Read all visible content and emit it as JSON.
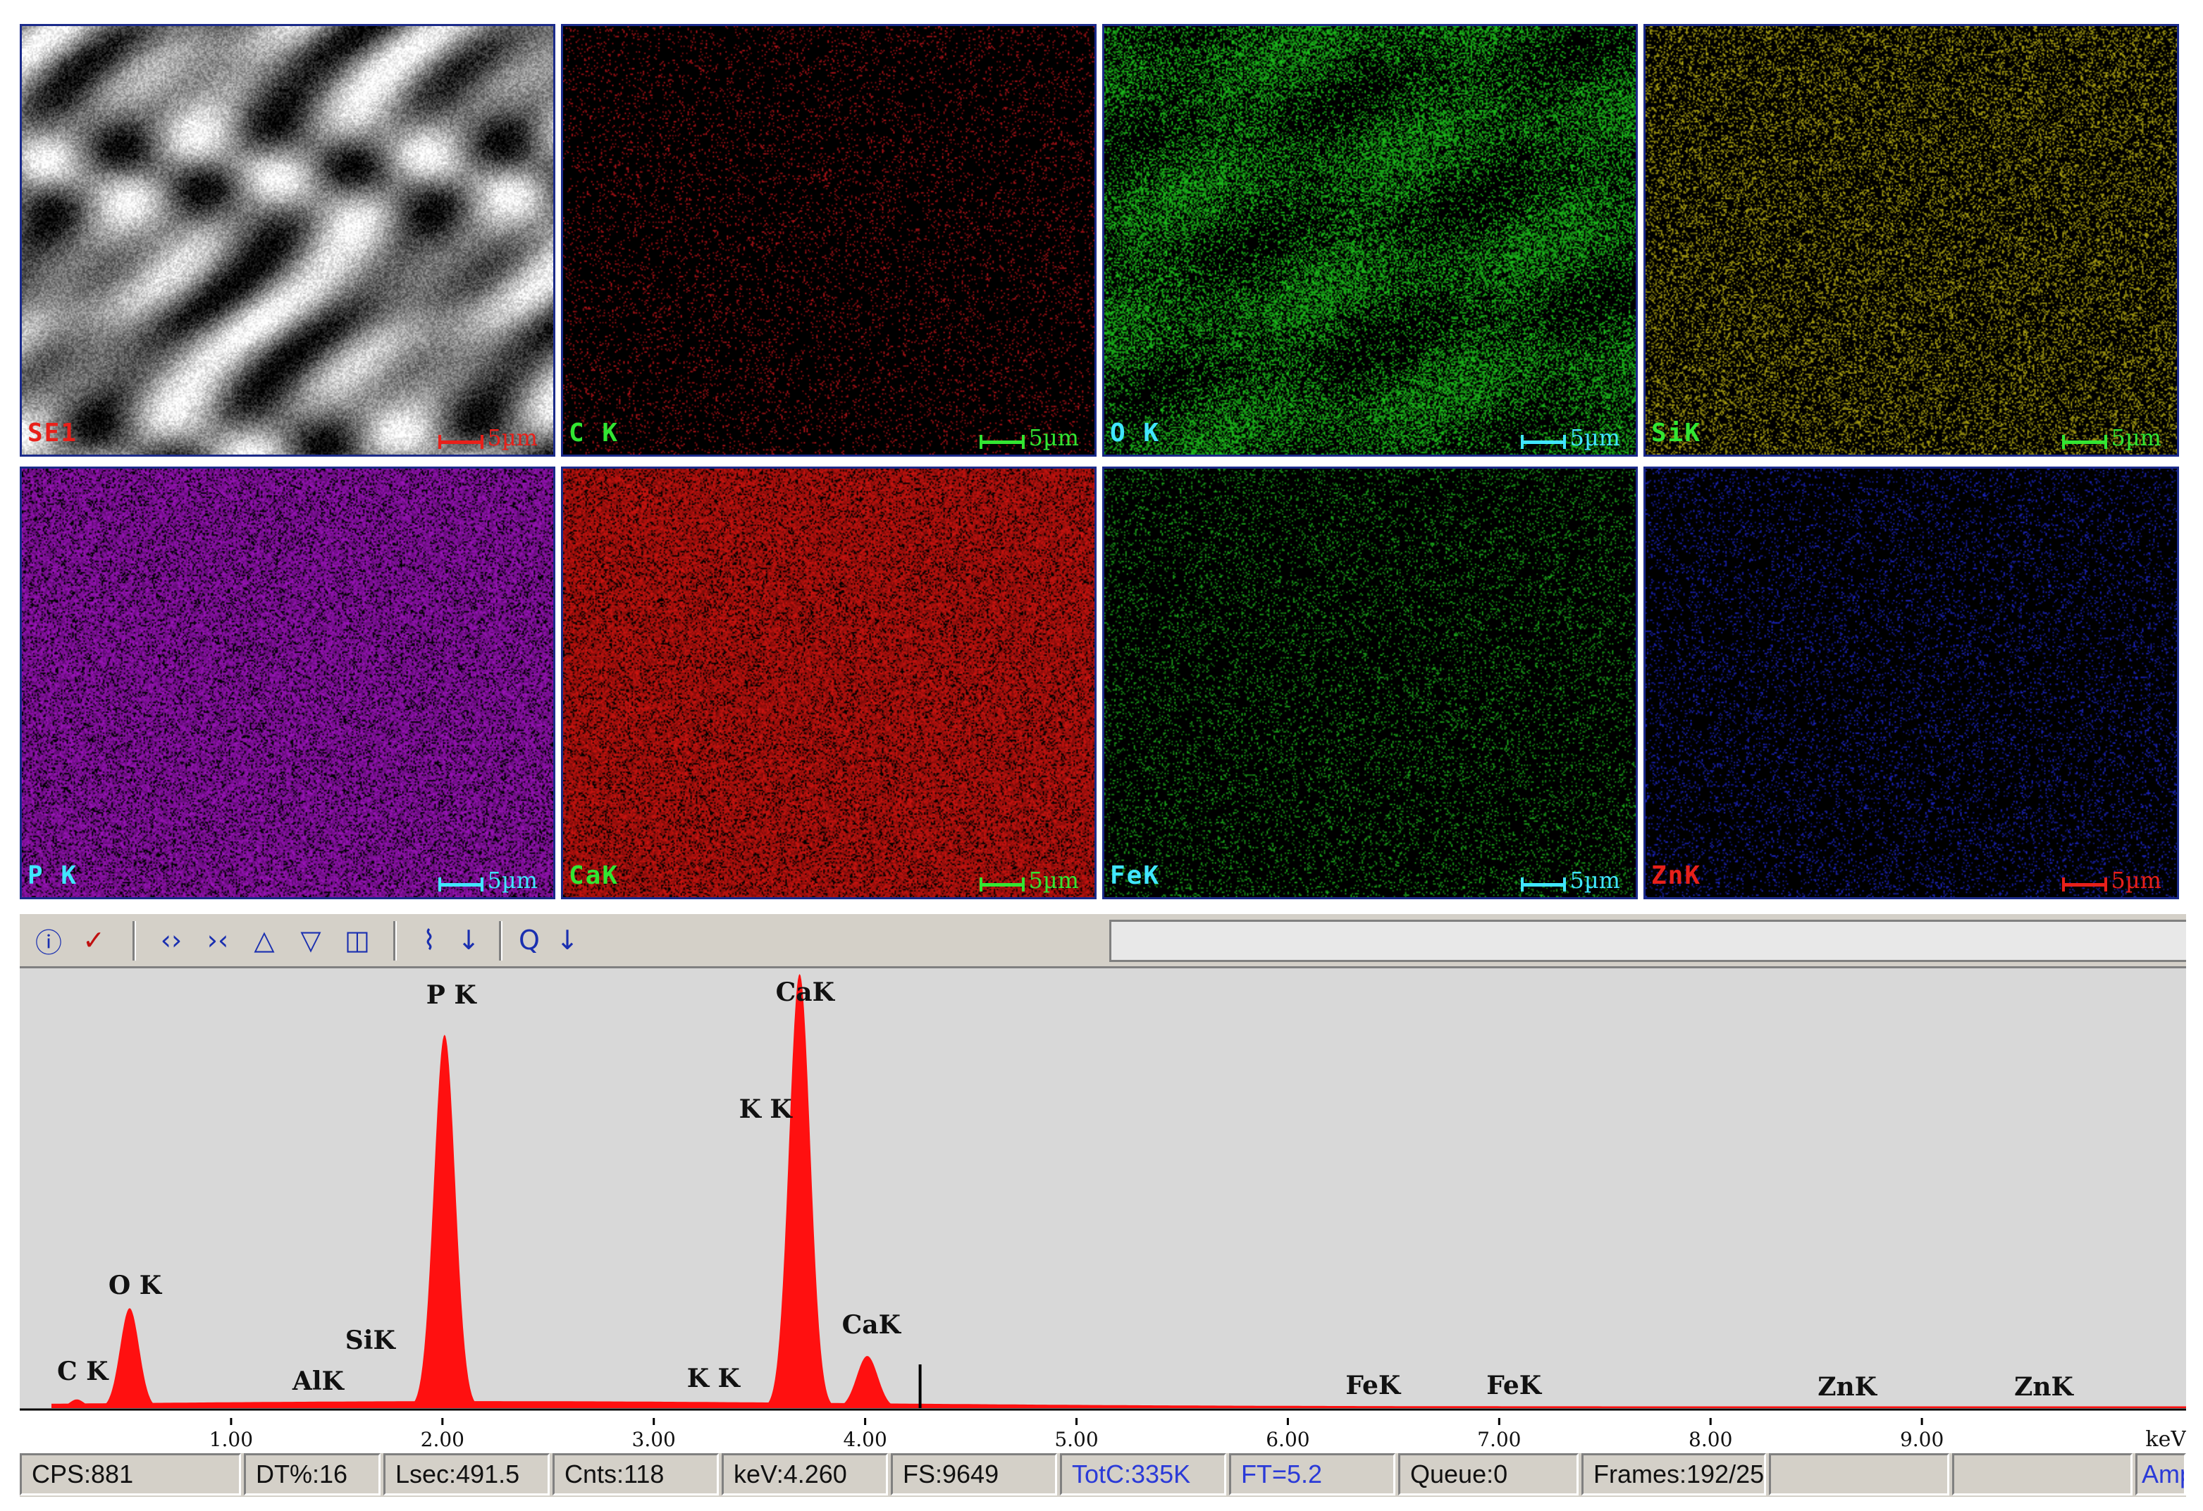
{
  "maps": [
    {
      "label": "SE1",
      "label_color": "#e8201a",
      "scale_text": "5µm",
      "scale_color": "#e8201a",
      "kind": "sem"
    },
    {
      "label": "C  K",
      "label_color": "#32e632",
      "scale_text": "5µm",
      "scale_color": "#32e632",
      "kind": "dots",
      "dot_color": "#c0141a",
      "density": 0.1
    },
    {
      "label": "O  K",
      "label_color": "#40e6ff",
      "scale_text": "5µm",
      "scale_color": "#40e6ff",
      "kind": "green",
      "dot_color": "#1ec81e",
      "density": 0.45
    },
    {
      "label": "SiK",
      "label_color": "#32e632",
      "scale_text": "5µm",
      "scale_color": "#32e632",
      "kind": "dots",
      "dot_color": "#b4aa14",
      "density": 0.28
    },
    {
      "label": "P  K",
      "label_color": "#40e6ff",
      "scale_text": "5µm",
      "scale_color": "#40e6ff",
      "kind": "dense",
      "dot_color": "#a014c0",
      "density": 0.8
    },
    {
      "label": "CaK",
      "label_color": "#32e632",
      "scale_text": "5µm",
      "scale_color": "#32e632",
      "kind": "dense",
      "dot_color": "#d21410",
      "density": 0.82
    },
    {
      "label": "FeK",
      "label_color": "#40e6ff",
      "scale_text": "5µm",
      "scale_color": "#40e6ff",
      "kind": "dots",
      "dot_color": "#1eb41e",
      "density": 0.14
    },
    {
      "label": "ZnK",
      "label_color": "#e8201a",
      "scale_text": "5µm",
      "scale_color": "#e8201a",
      "kind": "dots",
      "dot_color": "#1e28d2",
      "density": 0.12
    }
  ],
  "toolbar": {
    "icons": [
      "info-icon",
      "brush-icon",
      "expand-horizontal-icon",
      "compress-horizontal-icon",
      "expand-vertical-icon",
      "compress-vertical-icon",
      "eraser-icon",
      "peak-id-icon",
      "arrow-down-icon",
      "quantify-icon",
      "arrow-down-icon"
    ]
  },
  "chart_data": {
    "type": "line",
    "title": "",
    "xlabel": "keV",
    "ylabel": "",
    "xlim": [
      0,
      10.25
    ],
    "x_ticks": [
      "1.00",
      "2.00",
      "3.00",
      "4.00",
      "5.00",
      "6.00",
      "7.00",
      "8.00",
      "9.00"
    ],
    "x_tick_values": [
      1,
      2,
      3,
      4,
      5,
      6,
      7,
      8,
      9
    ],
    "marker_kev": 4.26,
    "peaks": [
      {
        "label": "C K",
        "kev": 0.27,
        "height": 0.02
      },
      {
        "label": "O K",
        "kev": 0.52,
        "height": 0.23
      },
      {
        "label": "AlK",
        "kev": 1.49,
        "height": 0.006
      },
      {
        "label": "SiK",
        "kev": 1.74,
        "height": 0.012
      },
      {
        "label": "P K",
        "kev": 2.01,
        "height": 0.86
      },
      {
        "label": "K K",
        "kev": 3.31,
        "height": 0.006
      },
      {
        "label": "CaK",
        "kev": 3.69,
        "height": 1.0
      },
      {
        "label": "K K",
        "kev": 3.59,
        "height": 0.0
      },
      {
        "label": "CaK",
        "kev": 4.01,
        "height": 0.12
      },
      {
        "label": "FeK",
        "kev": 6.4,
        "height": 0.004
      },
      {
        "label": "FeK",
        "kev": 7.06,
        "height": 0.003
      },
      {
        "label": "ZnK",
        "kev": 8.64,
        "height": 0.003
      },
      {
        "label": "ZnK",
        "kev": 9.57,
        "height": 0.003
      }
    ]
  },
  "status": {
    "cps": "CPS:881",
    "dt": "DT%:16",
    "lsec": "Lsec:491.5",
    "cnts": "Cnts:118",
    "kev": "keV:4.260",
    "fs": "FS:9649",
    "totc": "TotC:335K",
    "ft": "FT=5.2",
    "queue": "Queue:0",
    "frames": "Frames:192/25",
    "empty1": "",
    "empty2": "",
    "amp": "AmpT"
  }
}
